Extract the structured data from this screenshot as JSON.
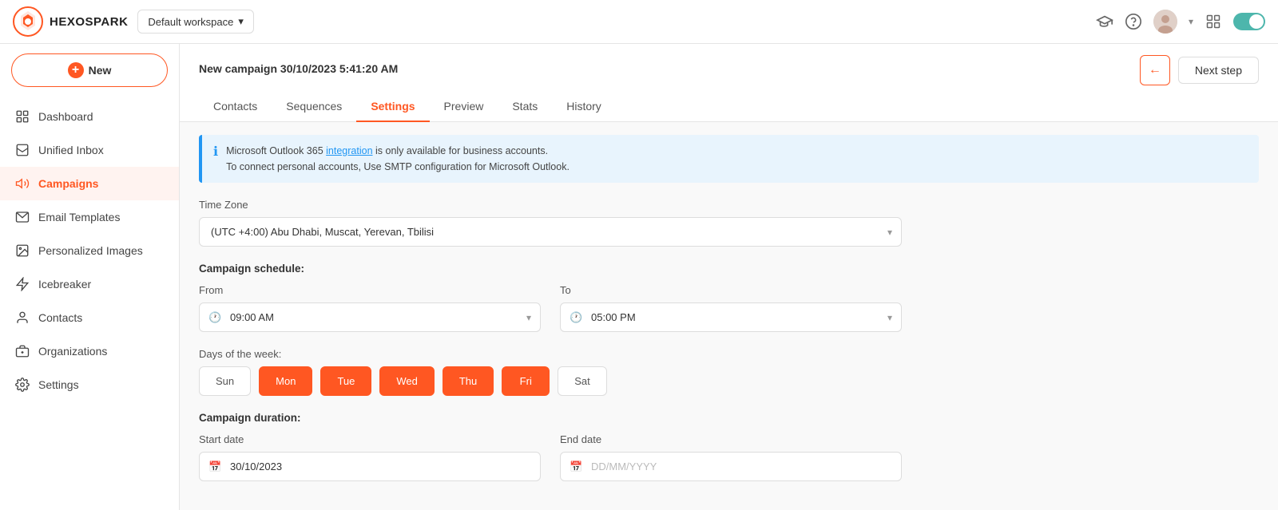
{
  "app": {
    "name": "HEXOSPARK",
    "workspace": "Default workspace"
  },
  "topbar": {
    "workspace_label": "Default workspace",
    "icons": [
      "graduation-cap",
      "question-circle",
      "avatar",
      "grid",
      "toggle"
    ]
  },
  "sidebar": {
    "new_button_label": "New",
    "items": [
      {
        "id": "dashboard",
        "label": "Dashboard",
        "icon": "grid-icon",
        "active": false
      },
      {
        "id": "unified-inbox",
        "label": "Unified Inbox",
        "icon": "inbox-icon",
        "active": false
      },
      {
        "id": "campaigns",
        "label": "Campaigns",
        "icon": "megaphone-icon",
        "active": true
      },
      {
        "id": "email-templates",
        "label": "Email Templates",
        "icon": "email-icon",
        "active": false
      },
      {
        "id": "personalized-images",
        "label": "Personalized Images",
        "icon": "image-icon",
        "active": false
      },
      {
        "id": "icebreaker",
        "label": "Icebreaker",
        "icon": "lightning-icon",
        "active": false
      },
      {
        "id": "contacts",
        "label": "Contacts",
        "icon": "contact-icon",
        "active": false
      },
      {
        "id": "organizations",
        "label": "Organizations",
        "icon": "org-icon",
        "active": false
      },
      {
        "id": "settings",
        "label": "Settings",
        "icon": "settings-icon",
        "active": false
      }
    ]
  },
  "campaign": {
    "title": "New campaign 30/10/2023 5:41:20 AM",
    "tabs": [
      {
        "id": "contacts",
        "label": "Contacts",
        "active": false
      },
      {
        "id": "sequences",
        "label": "Sequences",
        "active": false
      },
      {
        "id": "settings",
        "label": "Settings",
        "active": true
      },
      {
        "id": "preview",
        "label": "Preview",
        "active": false
      },
      {
        "id": "stats",
        "label": "Stats",
        "active": false
      },
      {
        "id": "history",
        "label": "History",
        "active": false
      }
    ],
    "back_button_label": "←",
    "next_step_label": "Next step"
  },
  "info_banner": {
    "line1": "Microsoft Outlook 365 integration is only available for business accounts.",
    "line2": "To connect personal accounts, Use SMTP configuration for Microsoft Outlook.",
    "link_text": "integration"
  },
  "settings": {
    "timezone_label": "Time Zone",
    "timezone_value": "(UTC +4:00) Abu Dhabi, Muscat, Yerevan, Tbilisi",
    "schedule_label": "Campaign schedule:",
    "from_label": "From",
    "from_value": "09:00 AM",
    "to_label": "To",
    "to_value": "05:00 PM",
    "days_label": "Days of the week:",
    "days": [
      {
        "id": "sun",
        "label": "Sun",
        "active": false
      },
      {
        "id": "mon",
        "label": "Mon",
        "active": true
      },
      {
        "id": "tue",
        "label": "Tue",
        "active": true
      },
      {
        "id": "wed",
        "label": "Wed",
        "active": true
      },
      {
        "id": "thu",
        "label": "Thu",
        "active": true
      },
      {
        "id": "fri",
        "label": "Fri",
        "active": true
      },
      {
        "id": "sat",
        "label": "Sat",
        "active": false
      }
    ],
    "duration_label": "Campaign duration:",
    "start_date_label": "Start date",
    "start_date_value": "30/10/2023",
    "end_date_label": "End date",
    "end_date_placeholder": "DD/MM/YYYY"
  }
}
